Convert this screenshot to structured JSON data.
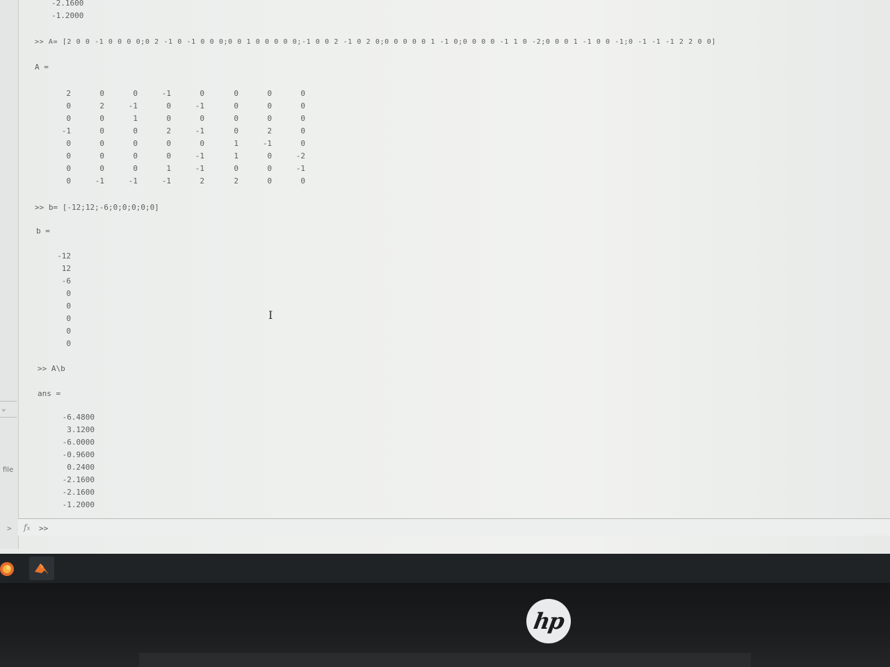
{
  "sidebar": {
    "file_label": "file",
    "expand_arrow": ">",
    "collapse_icon": "chevron-down-icon"
  },
  "console": {
    "prev_tail": [
      "-2.1600",
      "-1.2000"
    ],
    "cmd_A": ">> A= [2 0 0 -1 0 0 0 0;0 2 -1 0 -1 0 0 0;0 0 1 0 0 0 0 0;-1 0 0 2 -1 0 2 0;0 0 0 0 0 1 -1 0;0 0 0 0 -1 1 0 -2;0 0 0 1 -1 0 0 -1;0 -1 -1 -1 2 2 0 0]",
    "A_label": "A =",
    "A_matrix": [
      [
        "2",
        "0",
        "0",
        "-1",
        "0",
        "0",
        "0",
        "0"
      ],
      [
        "0",
        "2",
        "-1",
        "0",
        "-1",
        "0",
        "0",
        "0"
      ],
      [
        "0",
        "0",
        "1",
        "0",
        "0",
        "0",
        "0",
        "0"
      ],
      [
        "-1",
        "0",
        "0",
        "2",
        "-1",
        "0",
        "2",
        "0"
      ],
      [
        "0",
        "0",
        "0",
        "0",
        "0",
        "1",
        "-1",
        "0"
      ],
      [
        "0",
        "0",
        "0",
        "0",
        "-1",
        "1",
        "0",
        "-2"
      ],
      [
        "0",
        "0",
        "0",
        "1",
        "-1",
        "0",
        "0",
        "-1"
      ],
      [
        "0",
        "-1",
        "-1",
        "-1",
        "2",
        "2",
        "0",
        "0"
      ]
    ],
    "cmd_b": ">> b= [-12;12;-6;0;0;0;0;0]",
    "b_label": "b =",
    "b_vector": [
      "-12",
      "12",
      "-6",
      "0",
      "0",
      "0",
      "0",
      "0"
    ],
    "cmd_solve": ">> A\\b",
    "ans_label": "ans =",
    "ans_vector": [
      "-6.4800",
      "3.1200",
      "-6.0000",
      "-0.9600",
      "0.2400",
      "-2.1600",
      "-2.1600",
      "-1.2000"
    ],
    "prompt": ">>",
    "prompt_icon": "fx-icon"
  },
  "taskbar": {
    "apps": [
      "firefox-icon",
      "matlab-icon"
    ]
  },
  "monitor": {
    "brand": "hp",
    "brand_icon": "hp-logo"
  }
}
